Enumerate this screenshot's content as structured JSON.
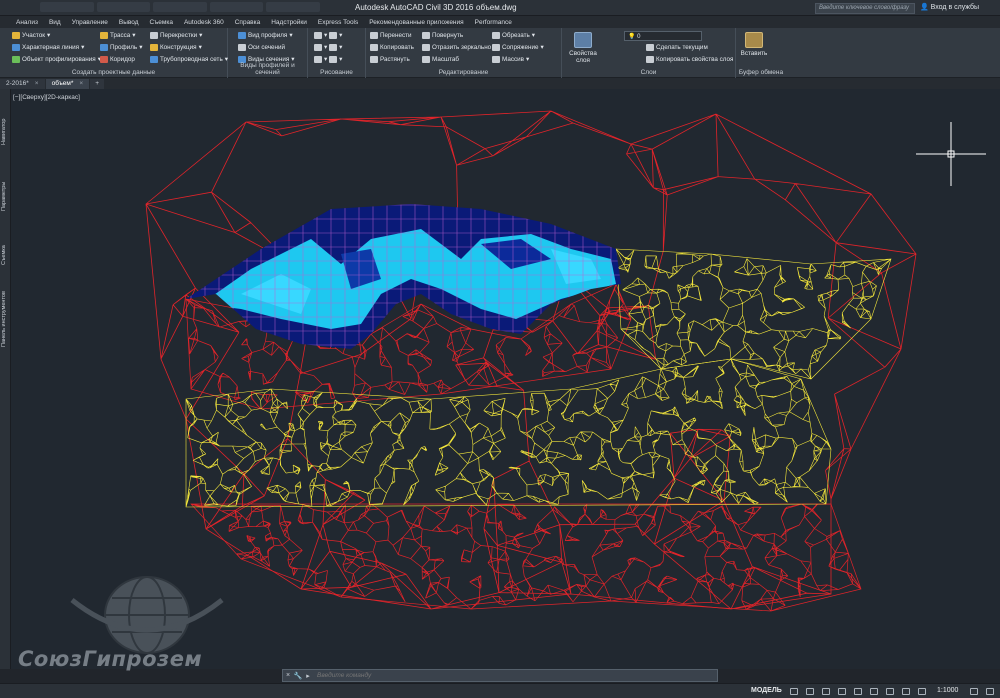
{
  "title_bar": {
    "app_title": "Autodesk AutoCAD Civil 3D 2016",
    "file_title": "объем.dwg",
    "help_search_placeholder": "Введите ключевое слово/фразу",
    "sign_in": "Вход в службы"
  },
  "ribbon_tabs": [
    "Анализ",
    "Вид",
    "Управление",
    "Вывод",
    "Съемка",
    "Autodesk 360",
    "Справка",
    "Надстройки",
    "Express Tools",
    "Рекомендованные приложения",
    "Performance"
  ],
  "ribbon": {
    "create_design": {
      "title": "Создать проектные данные",
      "items": [
        "Участок",
        "Характерная линия",
        "Объект профилирования",
        "Трасса",
        "Профиль",
        "Коридор",
        "Перекрестки",
        "Конструкция",
        "Трубопроводная сеть"
      ]
    },
    "profile_section_views": {
      "title": "Виды профилей и сечений",
      "items": [
        "Вид профиля",
        "Оси сечений",
        "Виды сечения"
      ]
    },
    "draw": {
      "title": "Рисование"
    },
    "modify": {
      "title": "Редактирование",
      "items": [
        "Перенести",
        "Копировать",
        "Растянуть",
        "Повернуть",
        "Отразить зеркально",
        "Масштаб",
        "Обрезать",
        "Сопряжение",
        "Массив"
      ]
    },
    "layers": {
      "title": "Слои",
      "layer_props_label": "Свойства слоя",
      "current_layer": "0",
      "items": [
        "Сделать текущим",
        "Копировать свойства слоя"
      ]
    },
    "clipboard": {
      "title": "Буфер обмена",
      "paste_label": "Вставить"
    }
  },
  "doc_tabs": [
    {
      "label": "2-2016*",
      "active": false
    },
    {
      "label": "объем*",
      "active": true
    }
  ],
  "left_palettes": [
    "Навигатор",
    "Параметры",
    "Съемка",
    "Панель инструментов"
  ],
  "viewport": {
    "label": "[−][Сверху][2D-каркас]"
  },
  "logo_text": "СоюзГипрозем",
  "command_line": {
    "placeholder": "Введите команду"
  },
  "status_bar": {
    "model_label": "МОДЕЛЬ",
    "scale": "1:1000"
  },
  "colors": {
    "background": "#212830",
    "outer_triangles": "#e0242a",
    "inner_triangles": "#f5e83c",
    "water_dark": "#0a1a78",
    "water_light": "#1ec8f0",
    "grid_lines": "#c060d0"
  }
}
